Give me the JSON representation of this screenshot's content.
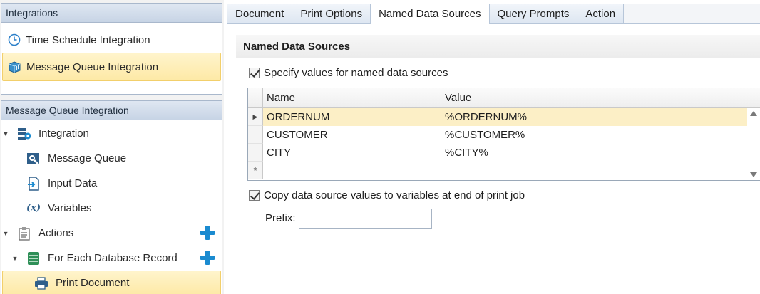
{
  "integrations_panel": {
    "header": "Integrations",
    "items": [
      {
        "label": "Time Schedule Integration",
        "icon": "clock-icon",
        "selected": false
      },
      {
        "label": "Message Queue Integration",
        "icon": "message-queue-icon",
        "selected": true
      }
    ]
  },
  "tree_panel": {
    "header": "Message Queue Integration",
    "items": [
      {
        "label": "Integration",
        "icon": "integration-icon",
        "expandable": true
      },
      {
        "label": "Message Queue",
        "icon": "message-queue-settings-icon"
      },
      {
        "label": "Input Data",
        "icon": "input-data-icon"
      },
      {
        "label": "Variables",
        "icon": "variables-icon",
        "icon_text": "(x)"
      },
      {
        "label": "Actions",
        "icon": "actions-icon",
        "expandable": true,
        "add": true
      },
      {
        "label": "For Each Database Record",
        "icon": "database-icon",
        "expandable": true,
        "add": true
      },
      {
        "label": "Print Document",
        "icon": "printer-icon",
        "selected": true
      }
    ]
  },
  "tabs": [
    {
      "label": "Document",
      "active": false
    },
    {
      "label": "Print Options",
      "active": false
    },
    {
      "label": "Named Data Sources",
      "active": true
    },
    {
      "label": "Query Prompts",
      "active": false
    },
    {
      "label": "Action",
      "active": false
    }
  ],
  "main": {
    "section_title": "Named Data Sources",
    "specify_checkbox": {
      "label": "Specify values for named data sources",
      "checked": true
    },
    "grid": {
      "columns": [
        "Name",
        "Value"
      ],
      "rows": [
        {
          "name": "ORDERNUM",
          "value": "%ORDERNUM%",
          "selected": true
        },
        {
          "name": "CUSTOMER",
          "value": "%CUSTOMER%",
          "selected": false
        },
        {
          "name": "CITY",
          "value": "%CITY%",
          "selected": false
        }
      ],
      "current_row_marker": "▶",
      "new_row_marker": "*"
    },
    "copy_checkbox": {
      "label": "Copy data source values to variables at end of print job",
      "checked": true
    },
    "prefix": {
      "label": "Prefix:",
      "value": ""
    }
  },
  "colors": {
    "accent": "#1b8bd0",
    "selection": "#fde9a6",
    "panel_header": "#c7d4e5"
  }
}
